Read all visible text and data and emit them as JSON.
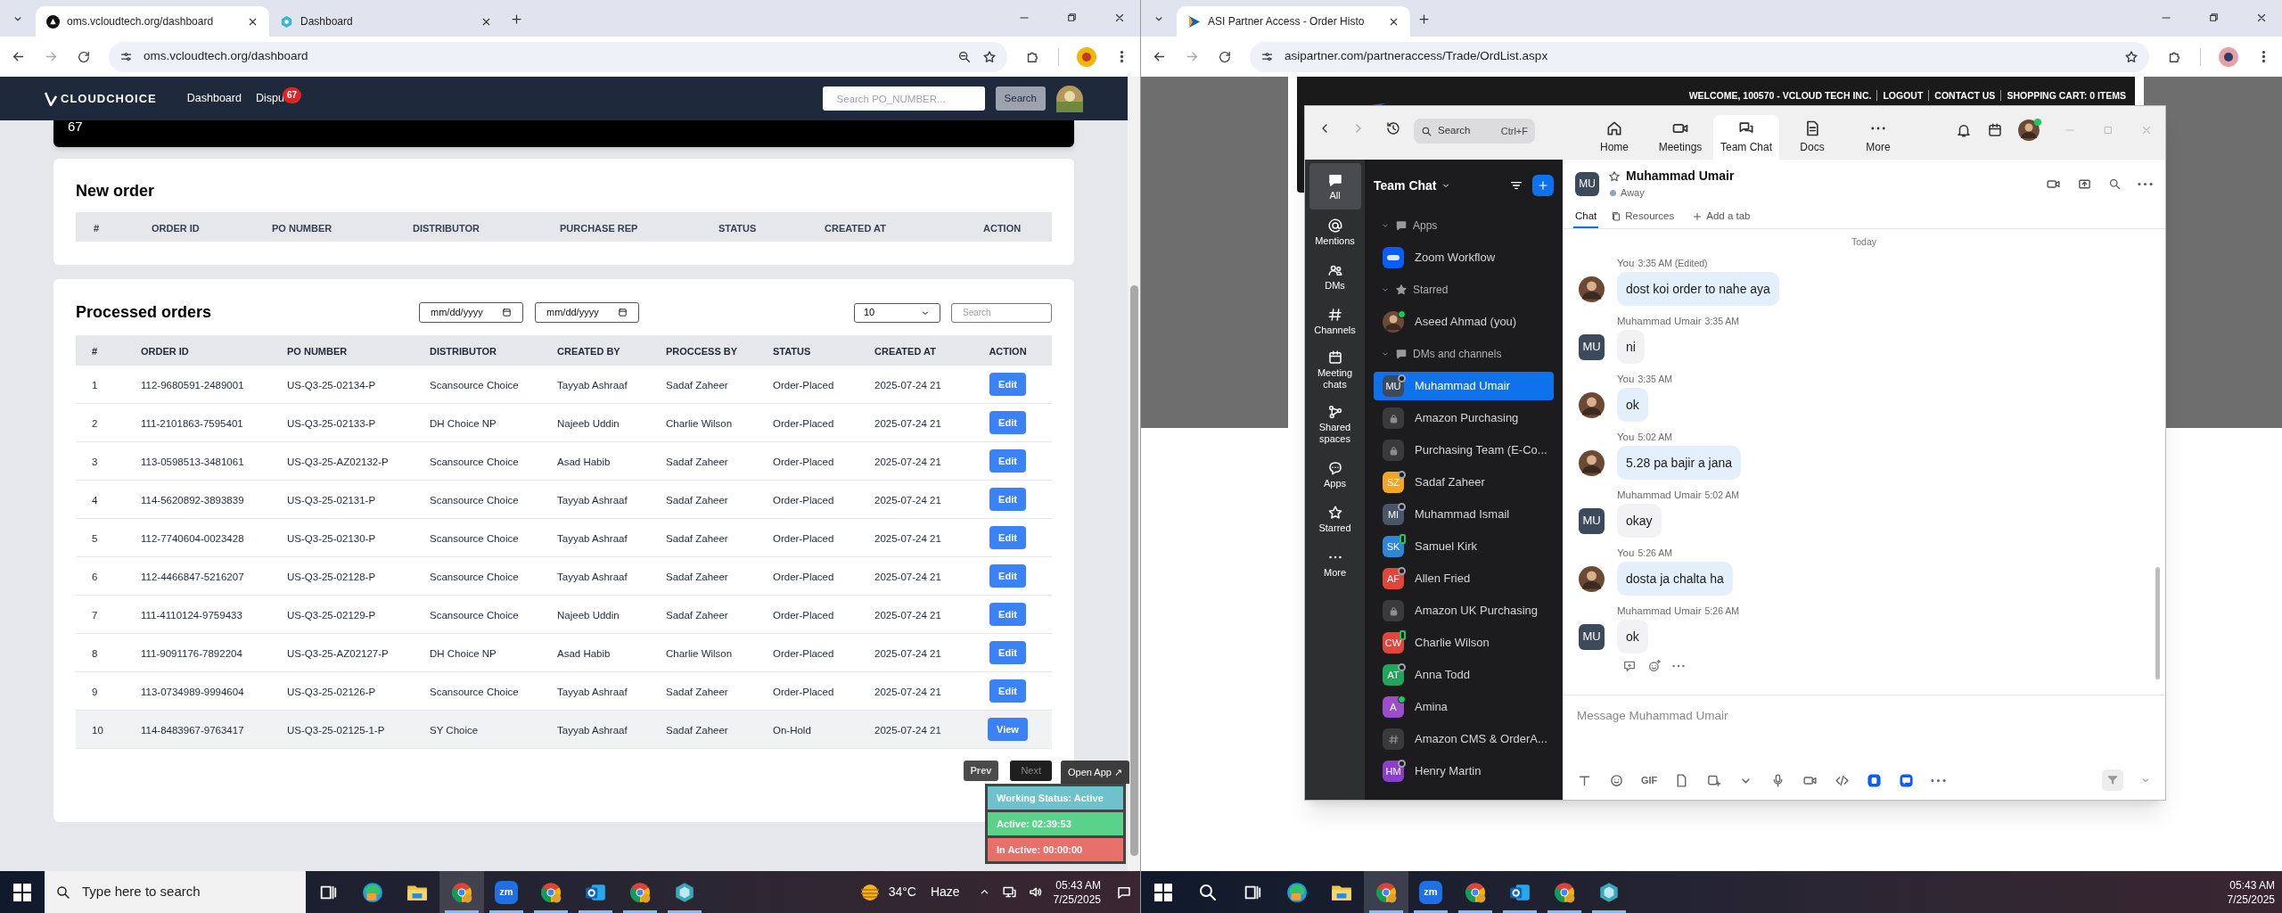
{
  "left_browser": {
    "tabs": [
      {
        "title": "oms.vcloudtech.org/dashboard",
        "selected": true
      },
      {
        "title": "Dashboard",
        "selected": false
      }
    ],
    "url": "oms.vcloudtech.org/dashboard"
  },
  "oms": {
    "brand": "CLOUDCHOICE",
    "nav": [
      {
        "label": "Dashboard"
      },
      {
        "label": "Dispu",
        "badge": "67"
      }
    ],
    "search_placeholder": "Search PO_NUMBER...",
    "search_button": "Search",
    "top_card_value": "67",
    "new_order": {
      "title": "New order",
      "columns": [
        "#",
        "ORDER ID",
        "PO NUMBER",
        "DISTRIBUTOR",
        "PURCHASE REP",
        "STATUS",
        "CREATED AT",
        "ACTION"
      ]
    },
    "processed": {
      "title": "Processed orders",
      "date_from": "mm/dd/yyyy",
      "date_to": "mm/dd/yyyy",
      "page_size": "10",
      "search_placeholder": "Search",
      "columns": [
        "#",
        "ORDER ID",
        "PO NUMBER",
        "DISTRIBUTOR",
        "CREATED BY",
        "PROCCESS BY",
        "STATUS",
        "CREATED AT",
        "ACTION"
      ],
      "rows": [
        {
          "cells": [
            "1",
            "112-9680591-2489001",
            "US-Q3-25-02134-P",
            "Scansource Choice",
            "Tayyab Ashraaf",
            "Sadaf Zaheer",
            "Order-Placed",
            "2025-07-24 21"
          ],
          "action": "Edit",
          "highlighted": false
        },
        {
          "cells": [
            "2",
            "111-2101863-7595401",
            "US-Q3-25-02133-P",
            "DH Choice NP",
            "Najeeb Uddin",
            "Charlie Wilson",
            "Order-Placed",
            "2025-07-24 21"
          ],
          "action": "Edit",
          "highlighted": false
        },
        {
          "cells": [
            "3",
            "113-0598513-3481061",
            "US-Q3-25-AZ02132-P",
            "Scansource Choice",
            "Asad Habib",
            "Sadaf Zaheer",
            "Order-Placed",
            "2025-07-24 21"
          ],
          "action": "Edit",
          "highlighted": false
        },
        {
          "cells": [
            "4",
            "114-5620892-3893839",
            "US-Q3-25-02131-P",
            "Scansource Choice",
            "Tayyab Ashraaf",
            "Sadaf Zaheer",
            "Order-Placed",
            "2025-07-24 21"
          ],
          "action": "Edit",
          "highlighted": false
        },
        {
          "cells": [
            "5",
            "112-7740604-0023428",
            "US-Q3-25-02130-P",
            "Scansource Choice",
            "Tayyab Ashraaf",
            "Sadaf Zaheer",
            "Order-Placed",
            "2025-07-24 21"
          ],
          "action": "Edit",
          "highlighted": false
        },
        {
          "cells": [
            "6",
            "112-4466847-5216207",
            "US-Q3-25-02128-P",
            "Scansource Choice",
            "Tayyab Ashraaf",
            "Sadaf Zaheer",
            "Order-Placed",
            "2025-07-24 21"
          ],
          "action": "Edit",
          "highlighted": false
        },
        {
          "cells": [
            "7",
            "111-4110124-9759433",
            "US-Q3-25-02129-P",
            "Scansource Choice",
            "Najeeb Uddin",
            "Sadaf Zaheer",
            "Order-Placed",
            "2025-07-24 21"
          ],
          "action": "Edit",
          "highlighted": false
        },
        {
          "cells": [
            "8",
            "111-9091176-7892204",
            "US-Q3-25-AZ02127-P",
            "DH Choice NP",
            "Asad Habib",
            "Charlie Wilson",
            "Order-Placed",
            "2025-07-24 21"
          ],
          "action": "Edit",
          "highlighted": false
        },
        {
          "cells": [
            "9",
            "113-0734989-9994604",
            "US-Q3-25-02126-P",
            "Scansource Choice",
            "Tayyab Ashraaf",
            "Sadaf Zaheer",
            "Order-Placed",
            "2025-07-24 21"
          ],
          "action": "Edit",
          "highlighted": false
        },
        {
          "cells": [
            "10",
            "114-8483967-9763417",
            "US-Q3-25-02125-1-P",
            "SY Choice",
            "Tayyab Ashraaf",
            "Sadaf Zaheer",
            "On-Hold",
            "2025-07-24 21"
          ],
          "action": "View",
          "highlighted": true
        }
      ],
      "prev": "Prev",
      "next": "Next"
    },
    "widget": {
      "open_app": "Open App ↗",
      "rows": [
        {
          "text": "Working Status: Active",
          "color": "#6fc2cc"
        },
        {
          "text": "Active: 02:39:53",
          "color": "#5ad28a"
        },
        {
          "text": "In Active: 00:00:00",
          "color": "#e8706a"
        }
      ]
    }
  },
  "right_browser": {
    "tabs": [
      {
        "title": "ASI Partner Access - Order Histo",
        "selected": true
      }
    ],
    "url": "asipartner.com/partneraccess/Trade/OrdList.aspx"
  },
  "asi": {
    "header_links": [
      "WELCOME, 100570 - VCLOUD TECH INC.",
      "LOGOUT",
      "CONTACT US",
      "SHOPPING CART: 0 ITEMS"
    ]
  },
  "zoom": {
    "search": "Search",
    "shortcut": "Ctrl+F",
    "tabs": [
      {
        "label": "Home",
        "selected": false
      },
      {
        "label": "Meetings",
        "selected": false
      },
      {
        "label": "Team Chat",
        "selected": true
      },
      {
        "label": "Docs",
        "selected": false
      },
      {
        "label": "More",
        "selected": false
      }
    ],
    "rail": [
      {
        "label": "All",
        "selected": true
      },
      {
        "label": "Mentions",
        "selected": false
      },
      {
        "label": "DMs",
        "selected": false
      },
      {
        "label": "Channels",
        "selected": false
      },
      {
        "label": "Meeting chats",
        "selected": false
      },
      {
        "label": "Shared spaces",
        "selected": false
      },
      {
        "label": "Apps",
        "selected": false
      },
      {
        "label": "Starred",
        "selected": false
      },
      {
        "label": "More",
        "selected": false
      }
    ],
    "sidebar_title": "Team Chat",
    "sections": [
      {
        "title": "Apps",
        "items": [
          {
            "kind": "app",
            "name": "Zoom Workflow",
            "selected": false
          }
        ]
      },
      {
        "title": "Starred",
        "items": [
          {
            "kind": "photo",
            "name": "Aseed Ahmad (you)",
            "presence": {
              "kind": "online"
            },
            "selected": false
          }
        ]
      },
      {
        "title": "DMs and channels",
        "items": [
          {
            "kind": "initials",
            "initials": "MU",
            "color": "#3d4a5c",
            "name": "Muhammad Umair",
            "presence": {
              "kind": "away"
            },
            "selected": true
          },
          {
            "kind": "lock",
            "name": "Amazon Purchasing",
            "selected": false
          },
          {
            "kind": "lock",
            "name": "Purchasing Team (E-Co...",
            "selected": false
          },
          {
            "kind": "initials",
            "initials": "SZ",
            "color": "#f5a524",
            "name": "Sadaf Zaheer",
            "presence": {
              "kind": "away"
            },
            "selected": false
          },
          {
            "kind": "initials",
            "initials": "MI",
            "color": "#4a5568",
            "name": "Muhammad Ismail",
            "presence": {
              "kind": "away"
            },
            "selected": false
          },
          {
            "kind": "initials",
            "initials": "SK",
            "color": "#2f86d6",
            "name": "Samuel Kirk",
            "presence": {
              "kind": "mobile"
            },
            "selected": false
          },
          {
            "kind": "initials",
            "initials": "AF",
            "color": "#e0463b",
            "name": "Allen Fried",
            "presence": {
              "kind": "away"
            },
            "selected": false
          },
          {
            "kind": "lock",
            "name": "Amazon UK Purchasing",
            "selected": false
          },
          {
            "kind": "initials",
            "initials": "CW",
            "color": "#e0463b",
            "name": "Charlie Wilson",
            "presence": {
              "kind": "mobile"
            },
            "selected": false
          },
          {
            "kind": "initials",
            "initials": "AT",
            "color": "#22a55a",
            "name": "Anna Todd",
            "presence": {
              "kind": "away"
            },
            "selected": false
          },
          {
            "kind": "initials",
            "initials": "A",
            "color": "#9b4dca",
            "name": "Amina",
            "presence": {
              "kind": "online"
            },
            "selected": false
          },
          {
            "kind": "channel",
            "name": "Amazon CMS & OrderA...",
            "selected": false
          },
          {
            "kind": "initials",
            "initials": "HM",
            "color": "#8a3ec9",
            "name": "Henry Martin",
            "presence": {
              "kind": "away"
            },
            "selected": false
          }
        ]
      }
    ],
    "chat": {
      "initials": "MU",
      "name": "Muhammad Umair",
      "status": "Away",
      "tabs": [
        {
          "label": "Chat",
          "selected": true
        },
        {
          "label": "Resources",
          "selected": false
        },
        {
          "label": "Add a tab",
          "selected": false
        }
      ],
      "day": "Today",
      "messages": [
        {
          "kind": "sent",
          "sender": "You",
          "time": "3:35 AM (Edited)",
          "text": "dost koi order to nahe aya"
        },
        {
          "kind": "received",
          "sender": "Muhammad Umair",
          "time": "3:35 AM",
          "text": "ni",
          "initials": "MU"
        },
        {
          "kind": "sent",
          "sender": "You",
          "time": "3:35 AM",
          "text": "ok"
        },
        {
          "kind": "sent",
          "sender": "You",
          "time": "5:02 AM",
          "text": "5.28 pa bajir a jana"
        },
        {
          "kind": "received",
          "sender": "Muhammad Umair",
          "time": "5:02 AM",
          "text": "okay",
          "initials": "MU"
        },
        {
          "kind": "sent",
          "sender": "You",
          "time": "5:26 AM",
          "text": "dosta ja chalta ha"
        },
        {
          "kind": "received",
          "sender": "Muhammad Umair",
          "time": "5:26 AM",
          "text": "ok",
          "initials": "MU"
        }
      ],
      "placeholder": "Message Muhammad Umair",
      "gif": "GIF"
    }
  },
  "taskbar_left": {
    "search_placeholder": "Type here to search",
    "apps": [
      {
        "kind": "taskview",
        "running": false
      },
      {
        "kind": "edge",
        "running": false
      },
      {
        "kind": "folder",
        "running": false
      },
      {
        "kind": "browser",
        "running": true,
        "active": true
      },
      {
        "kind": "zoom",
        "label": "zm",
        "running": true,
        "active": false
      },
      {
        "kind": "browser",
        "running": true,
        "active": false
      },
      {
        "kind": "outlook",
        "running": true,
        "active": false
      },
      {
        "kind": "browser",
        "running": true,
        "active": false
      },
      {
        "kind": "app",
        "running": true,
        "active": false
      }
    ],
    "temperature": "34°C",
    "weather": "Haze",
    "time": "05:43 AM",
    "date": "7/25/2025"
  },
  "taskbar_right": {
    "apps": [
      {
        "kind": "taskview",
        "running": false
      },
      {
        "kind": "edge",
        "running": false
      },
      {
        "kind": "folder",
        "running": false
      },
      {
        "kind": "browser",
        "running": true,
        "active": true
      },
      {
        "kind": "zoom",
        "label": "zm",
        "running": true,
        "active": false
      },
      {
        "kind": "browser",
        "running": true,
        "active": false
      },
      {
        "kind": "outlook",
        "running": true,
        "active": false
      },
      {
        "kind": "browser",
        "running": true,
        "active": false
      },
      {
        "kind": "app",
        "running": true,
        "active": false
      }
    ],
    "time": "05:43 AM",
    "date": "7/25/2025"
  }
}
